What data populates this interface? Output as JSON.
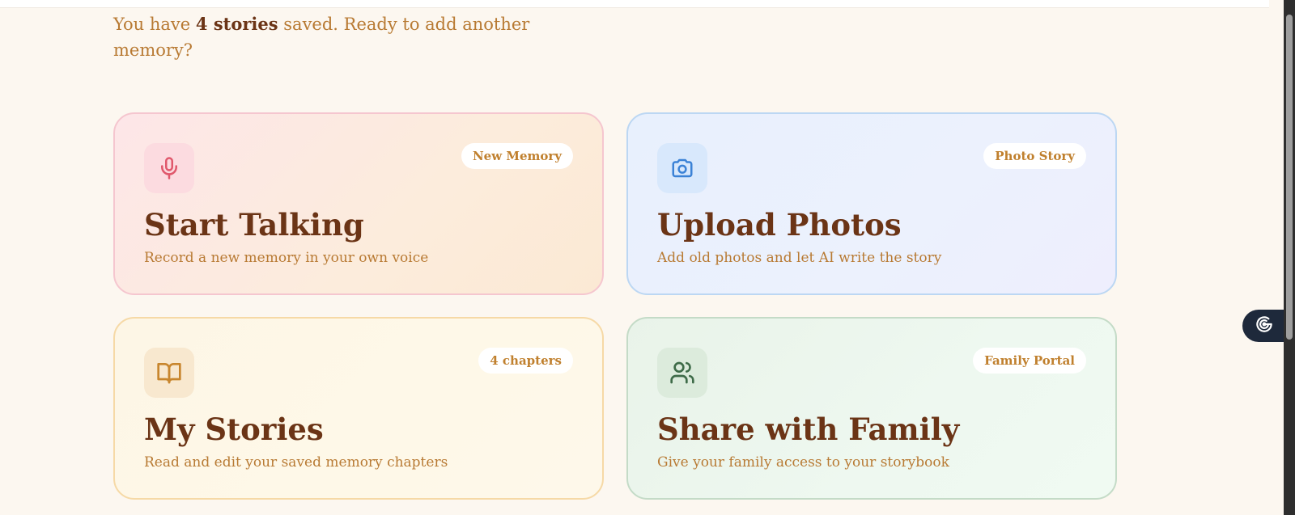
{
  "intro": {
    "prefix": "You have ",
    "count": "4 stories",
    "suffix": " saved. Ready to add another memory?"
  },
  "cards": [
    {
      "icon": "microphone-icon",
      "badge": "New Memory",
      "title": "Start Talking",
      "description": "Record a new memory in your own voice",
      "accent": "#e0586c"
    },
    {
      "icon": "camera-icon",
      "badge": "Photo Story",
      "title": "Upload Photos",
      "description": "Add old photos and let AI write the story",
      "accent": "#3b82d6"
    },
    {
      "icon": "book-icon",
      "badge": "4 chapters",
      "title": "My Stories",
      "description": "Read and edit your saved memory chapters",
      "accent": "#c8862e"
    },
    {
      "icon": "users-icon",
      "badge": "Family Portal",
      "title": "Share with Family",
      "description": "Give your family access to your storybook",
      "accent": "#3e6b48"
    }
  ],
  "side_fab": {
    "icon": "assistant-icon"
  },
  "colors": {
    "background": "#fcf7f0",
    "title": "#6b3416",
    "body_text": "#b87a33",
    "badge_text": "#c0802e"
  }
}
